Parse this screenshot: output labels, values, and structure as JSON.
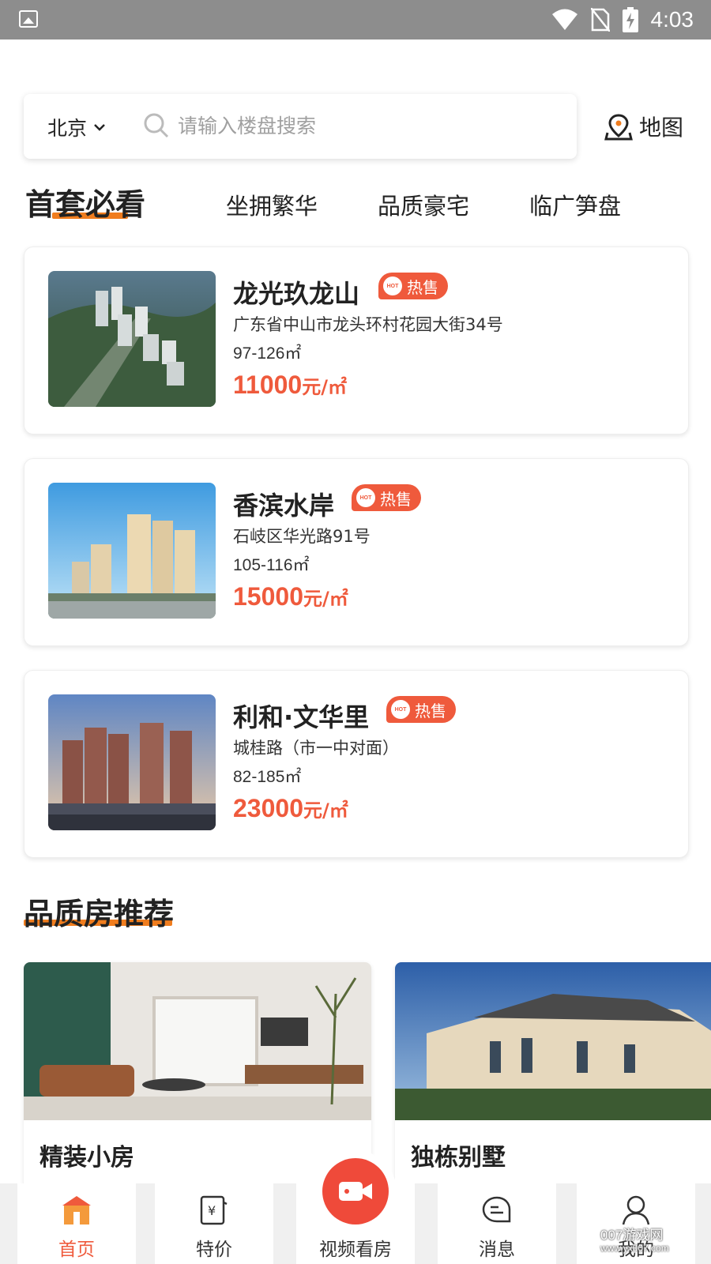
{
  "status_bar": {
    "time": "4:03"
  },
  "search": {
    "city": "北京",
    "placeholder": "请输入楼盘搜索",
    "map_label": "地图"
  },
  "category_tabs": {
    "active": "首套必看",
    "items": [
      "坐拥繁华",
      "品质豪宅",
      "临广笋盘"
    ]
  },
  "properties": [
    {
      "name": "龙光玖龙山",
      "badge": "热售",
      "badge_icon_text": "HOT",
      "address": "广东省中山市龙头环村花园大街34号",
      "area": "97-126㎡",
      "price": "11000",
      "price_unit": "元/㎡"
    },
    {
      "name": "香滨水岸",
      "badge": "热售",
      "badge_icon_text": "HOT",
      "address": "石岐区华光路91号",
      "area": "105-116㎡",
      "price": "15000",
      "price_unit": "元/㎡"
    },
    {
      "name": "利和·文华里",
      "badge": "热售",
      "badge_icon_text": "HOT",
      "address": "城桂路（市一中对面）",
      "area": "82-185㎡",
      "price": "23000",
      "price_unit": "元/㎡"
    }
  ],
  "recommend": {
    "title": "品质房推荐",
    "cards": [
      {
        "title": "精装小房"
      },
      {
        "title": "独栋别墅"
      }
    ]
  },
  "bottom_nav": {
    "items": [
      "首页",
      "特价",
      "视频看房",
      "消息",
      "我的"
    ],
    "active": "首页"
  },
  "watermark": {
    "line1": "007游戏网",
    "line2": "www.yx007.com"
  },
  "colors": {
    "accent": "#ef5a3c",
    "underline": "#f07d1e",
    "status_bar": "#8d8d8d"
  }
}
